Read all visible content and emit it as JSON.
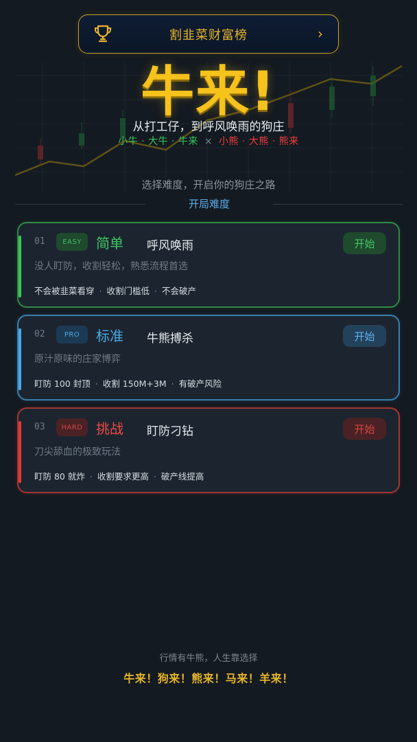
{
  "leaderboard": {
    "label": "割韭菜财富榜",
    "chevron": "›"
  },
  "hero": {
    "title": "牛来!",
    "subtitle": "从打工仔，到呼风唤雨的狗庄",
    "bull_tags": "小牛 · 大牛 · 牛来",
    "separator": "×",
    "bear_tags": "小熊 · 大熊 · 熊来"
  },
  "choose_hint": "选择难度，开启你的狗庄之路",
  "section_title": "开局难度",
  "difficulties": [
    {
      "number": "01",
      "badge": "EASY",
      "name": "简单",
      "tagline": "呼风唤雨",
      "description": "没人盯防，收割轻松，熟悉流程首选",
      "rules": [
        "不会被韭菜看穿",
        "收割门槛低",
        "不会破产"
      ],
      "start_label": "开始"
    },
    {
      "number": "02",
      "badge": "PRO",
      "name": "标准",
      "tagline": "牛熊搏杀",
      "description": "原汁原味的庄家博弈",
      "rules": [
        "盯防 100 封顶",
        "收割 150M+3M",
        "有破产风险"
      ],
      "start_label": "开始"
    },
    {
      "number": "03",
      "badge": "HARD",
      "name": "挑战",
      "tagline": "盯防刁钻",
      "description": "刀尖舔血的极致玩法",
      "rules": [
        "盯防 80 就炸",
        "收割要求更高",
        "破产线提高"
      ],
      "start_label": "开始"
    }
  ],
  "footer": {
    "line1": "行情有牛熊，人生靠选择",
    "line2": "牛来！狗来！熊来！马来！羊来！"
  },
  "colors": {
    "background": "#141a21",
    "gold": "#e7b52b",
    "bull_green": "#35c65a",
    "bear_red": "#ef3e3a",
    "pro_blue": "#4aa9e6"
  },
  "icons": {
    "leaderboard": "trophy-icon"
  }
}
